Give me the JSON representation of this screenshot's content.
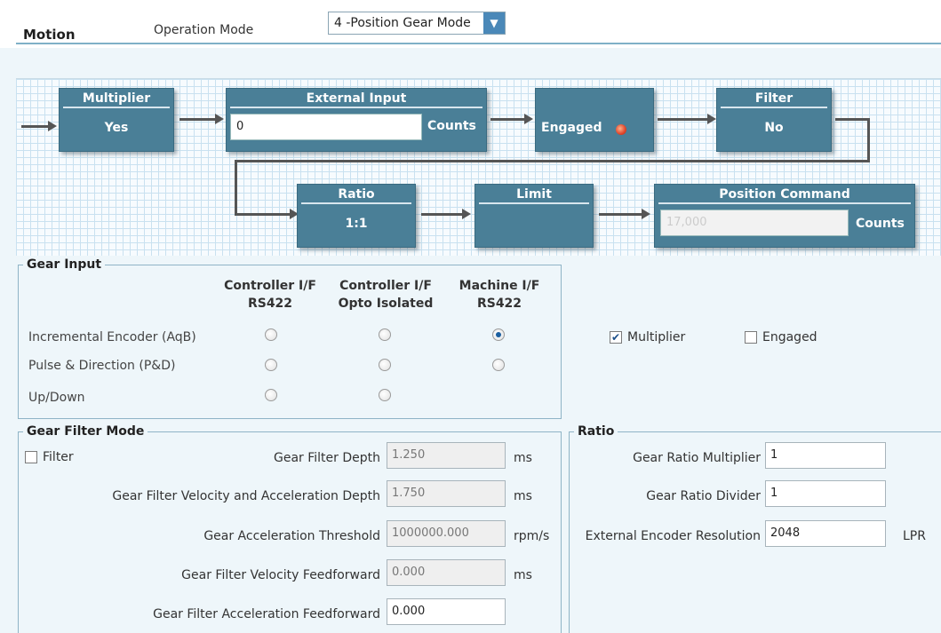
{
  "header": {
    "title": "Motion",
    "operation_mode_label": "Operation Mode",
    "operation_mode_value": "4 -Position Gear Mode"
  },
  "diagram": {
    "multiplier": {
      "title": "Multiplier",
      "value": "Yes"
    },
    "external_input": {
      "title": "External Input",
      "value": "0",
      "unit": "Counts"
    },
    "engaged": {
      "label": "Engaged"
    },
    "filter": {
      "title": "Filter",
      "value": "No"
    },
    "ratio": {
      "title": "Ratio",
      "value": "1:1"
    },
    "limit": {
      "title": "Limit"
    },
    "position_command": {
      "title": "Position Command",
      "value": "17,000",
      "unit": "Counts"
    }
  },
  "gear_input": {
    "legend": "Gear Input",
    "columns": [
      {
        "line1": "Controller I/F",
        "line2": "RS422"
      },
      {
        "line1": "Controller I/F",
        "line2": "Opto Isolated"
      },
      {
        "line1": "Machine I/F",
        "line2": "RS422"
      }
    ],
    "rows": [
      {
        "label": "Incremental Encoder (AqB)"
      },
      {
        "label": "Pulse & Direction (P&D)"
      },
      {
        "label": "Up/Down"
      }
    ],
    "selected": "Incremental Encoder (AqB) / Machine I/F RS422",
    "multiplier_checkbox": {
      "label": "Multiplier",
      "checked": true
    },
    "engaged_checkbox": {
      "label": "Engaged",
      "checked": false
    }
  },
  "gear_filter_mode": {
    "legend": "Gear Filter Mode",
    "filter_checkbox": {
      "label": "Filter",
      "checked": false
    },
    "fields": [
      {
        "label": "Gear Filter Depth",
        "value": "1.250",
        "unit": "ms"
      },
      {
        "label": "Gear Filter Velocity and Acceleration Depth",
        "value": "1.750",
        "unit": "ms"
      },
      {
        "label": "Gear Acceleration Threshold",
        "value": "1000000.000",
        "unit": "rpm/s"
      },
      {
        "label": "Gear Filter Velocity Feedforward",
        "value": "0.000",
        "unit": "ms"
      },
      {
        "label": "Gear Filter Acceleration Feedforward",
        "value": "0.000",
        "unit": ""
      }
    ]
  },
  "ratio": {
    "legend": "Ratio",
    "fields": [
      {
        "label": "Gear Ratio Multiplier",
        "value": "1",
        "unit": ""
      },
      {
        "label": "Gear Ratio Divider",
        "value": "1",
        "unit": ""
      },
      {
        "label": "External Encoder Resolution",
        "value": "2048",
        "unit": "LPR"
      }
    ]
  },
  "colors": {
    "block": "#4a7f97",
    "accent": "#4a88b8",
    "engaged_led": "#e0452a"
  }
}
